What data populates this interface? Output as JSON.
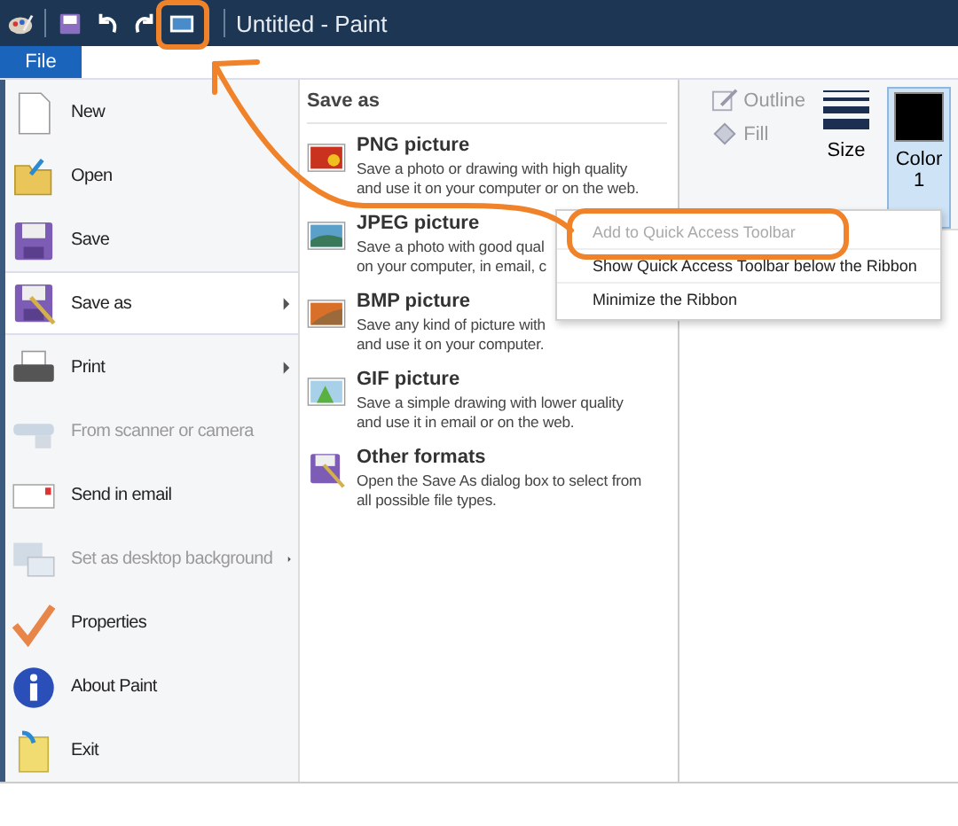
{
  "window": {
    "title": "Untitled - Paint"
  },
  "quick_access_toolbar": {
    "items": [
      {
        "circled": false
      },
      {
        "circled": false
      },
      {
        "circled": false
      },
      {
        "circled": false
      },
      {
        "circled": true
      }
    ]
  },
  "file_tab": {
    "label": "File",
    "selected": true
  },
  "file_menu": {
    "items": [
      {
        "label": "New",
        "kind": "new",
        "disabled": false,
        "selected": false,
        "has_submenu": false
      },
      {
        "label": "Open",
        "kind": "open",
        "disabled": false,
        "selected": false,
        "has_submenu": false
      },
      {
        "label": "Save",
        "kind": "save",
        "disabled": false,
        "selected": false,
        "has_submenu": false
      },
      {
        "label": "Save as",
        "kind": "saveas",
        "disabled": false,
        "selected": true,
        "has_submenu": true
      },
      {
        "label": "Print",
        "kind": "print",
        "disabled": false,
        "selected": false,
        "has_submenu": true
      },
      {
        "label": "From scanner or camera",
        "kind": "scanner",
        "disabled": true,
        "selected": false,
        "has_submenu": false
      },
      {
        "label": "Send in email",
        "kind": "email",
        "disabled": false,
        "selected": false,
        "has_submenu": false
      },
      {
        "label": "Set as desktop background",
        "kind": "desktop",
        "disabled": true,
        "selected": false,
        "has_submenu": true
      },
      {
        "label": "Properties",
        "kind": "properties",
        "disabled": false,
        "selected": false,
        "has_submenu": false
      },
      {
        "label": "About Paint",
        "kind": "about",
        "disabled": false,
        "selected": false,
        "has_submenu": false
      },
      {
        "label": "Exit",
        "kind": "exit",
        "disabled": false,
        "selected": false,
        "has_submenu": false
      }
    ]
  },
  "save_as_panel": {
    "title": "Save as",
    "options": [
      {
        "title": "PNG picture",
        "kind": "png",
        "lines": [
          "Save a photo or drawing with high quality",
          "and use it on your computer or on the web."
        ]
      },
      {
        "title": "JPEG picture",
        "kind": "jpeg",
        "lines": [
          "Save a photo with good qual",
          "on your computer, in email, c"
        ]
      },
      {
        "title": "BMP picture",
        "kind": "bmp",
        "lines": [
          "Save any kind of picture with",
          "and use it on your computer."
        ]
      },
      {
        "title": "GIF picture",
        "kind": "gif",
        "lines": [
          "Save a simple drawing with lower quality",
          "and use it in email or on the web."
        ]
      },
      {
        "title": "Other formats",
        "kind": "other",
        "lines": [
          "Open the Save As dialog box to select from",
          "all possible file types."
        ]
      }
    ]
  },
  "ribbon": {
    "outline": "Outline",
    "fill": "Fill",
    "size": "Size",
    "color_1": {
      "label": "Color",
      "number": "1",
      "selected": true
    }
  },
  "context_menu": {
    "items": [
      {
        "label": "Add to Quick Access Toolbar",
        "disabled": true,
        "circled": true
      },
      {
        "label": "Show Quick Access Toolbar below the Ribbon",
        "disabled": false,
        "circled": false
      },
      {
        "label": "Minimize the Ribbon",
        "disabled": false,
        "circled": false
      }
    ]
  }
}
